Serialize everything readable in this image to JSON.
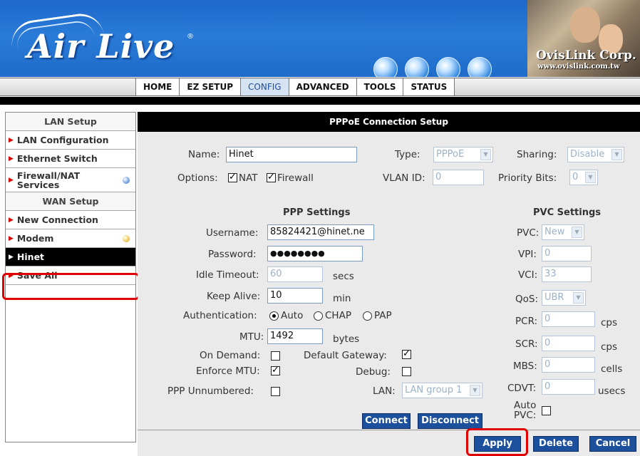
{
  "brand": {
    "logo_text": "Air Live",
    "registered_mark": "®",
    "company": "OvisLink Corp.",
    "company_url": "www.ovislink.com.tw"
  },
  "nav": {
    "tabs": [
      "HOME",
      "EZ SETUP",
      "CONFIG",
      "ADVANCED",
      "TOOLS",
      "STATUS"
    ],
    "active": "CONFIG"
  },
  "sidebar": {
    "lan_section": "LAN Setup",
    "lan_config": "LAN Configuration",
    "ethernet_switch": "Ethernet Switch",
    "firewall_line1": "Firewall/NAT",
    "firewall_line2": "Services",
    "wan_section": "WAN Setup",
    "new_connection": "New Connection",
    "modem": "Modem",
    "hinet": "Hinet",
    "save_all": "Save All",
    "arrow": "▶"
  },
  "page": {
    "title": "PPPoE Connection Setup"
  },
  "form": {
    "name_label": "Name:",
    "name_value": "Hinet",
    "type_label": "Type:",
    "type_value": "PPPoE",
    "sharing_label": "Sharing:",
    "sharing_value": "Disable",
    "options_label": "Options:",
    "nat_label": "NAT",
    "firewall_label": "Firewall",
    "nat_checked": true,
    "firewall_checked": true,
    "vlan_label": "VLAN ID:",
    "vlan_value": "0",
    "priority_label": "Priority Bits:",
    "priority_value": "0"
  },
  "ppp": {
    "title": "PPP Settings",
    "username_label": "Username:",
    "username_value": "85824421@hinet.ne",
    "password_label": "Password:",
    "password_value": "●●●●●●●●",
    "idle_label": "Idle Timeout:",
    "idle_value": "60",
    "idle_unit": "secs",
    "keepalive_label": "Keep Alive:",
    "keepalive_value": "10",
    "keepalive_unit": "min",
    "auth_label": "Authentication:",
    "auth_options": [
      "Auto",
      "CHAP",
      "PAP"
    ],
    "auth_selected": "Auto",
    "mtu_label": "MTU:",
    "mtu_value": "1492",
    "mtu_unit": "bytes",
    "on_demand_label": "On Demand:",
    "on_demand_checked": false,
    "default_gw_label": "Default Gateway:",
    "default_gw_checked": true,
    "enforce_mtu_label": "Enforce MTU:",
    "enforce_mtu_checked": true,
    "debug_label": "Debug:",
    "debug_checked": false,
    "unnumbered_label": "PPP Unnumbered:",
    "unnumbered_checked": false,
    "lan_label": "LAN:",
    "lan_value": "LAN group 1"
  },
  "pvc": {
    "title": "PVC Settings",
    "pvc_label": "PVC:",
    "pvc_value": "New",
    "vpi_label": "VPI:",
    "vpi_value": "0",
    "vci_label": "VCI:",
    "vci_value": "33",
    "qos_label": "QoS:",
    "qos_value": "UBR",
    "pcr_label": "PCR:",
    "pcr_value": "0",
    "pcr_unit": "cps",
    "scr_label": "SCR:",
    "scr_value": "0",
    "scr_unit": "cps",
    "mbs_label": "MBS:",
    "mbs_value": "0",
    "mbs_unit": "cells",
    "cdvt_label": "CDVT:",
    "cdvt_value": "0",
    "cdvt_unit": "usecs",
    "auto_pvc_line1": "Auto",
    "auto_pvc_line2": "PVC:",
    "auto_pvc_checked": false
  },
  "buttons": {
    "connect": "Connect",
    "disconnect": "Disconnect",
    "apply": "Apply",
    "delete": "Delete",
    "cancel": "Cancel"
  },
  "colors": {
    "banner": "#1f6cca",
    "button": "#1c4f9c",
    "highlight": "#e00000",
    "active_tab": "#d4e2f2"
  },
  "icons": {
    "checkbox_mark": "✓",
    "dropdown": "▼"
  }
}
